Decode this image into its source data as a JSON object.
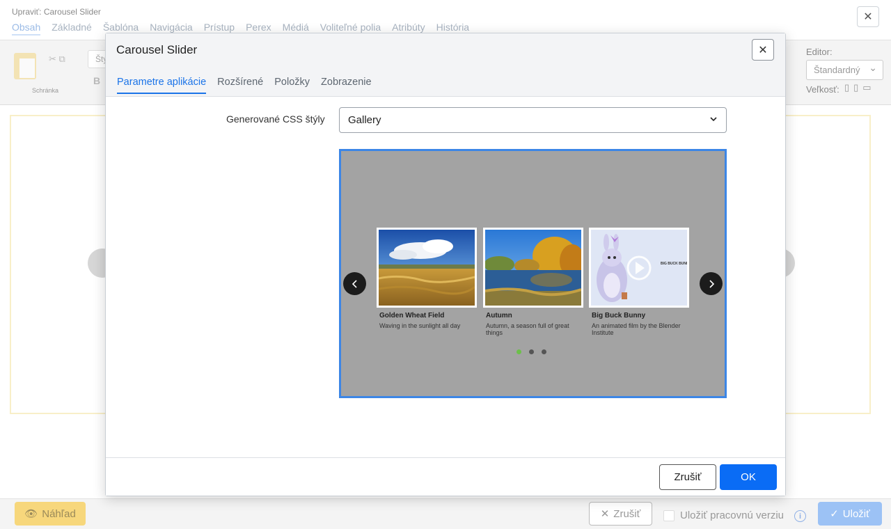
{
  "background": {
    "title": "Upraviť: Carousel Slider",
    "tabs": [
      "Obsah",
      "Základné",
      "Šablóna",
      "Navigácia",
      "Prístup",
      "Perex",
      "Médiá",
      "Voliteľné polia",
      "Atribúty",
      "História"
    ],
    "active_tab": "Obsah",
    "toolbar": {
      "clipboard_label": "Schránka",
      "style_placeholder": "Šty",
      "editor_label": "Editor:",
      "editor_value": "Štandardný",
      "size_label": "Veľkosť:"
    },
    "footer": {
      "preview_label": "Náhľad",
      "cancel_label": "Zrušiť",
      "draft_label": "Uložiť pracovnú verziu",
      "save_label": "Uložiť"
    }
  },
  "modal": {
    "title": "Carousel Slider",
    "tabs": [
      "Parametre aplikácie",
      "Rozšírené",
      "Položky",
      "Zobrazenie"
    ],
    "active_tab": "Parametre aplikácie",
    "field_label": "Generované CSS štýly",
    "field_value": "Gallery",
    "slides": [
      {
        "title": "Golden Wheat Field",
        "text": "Waving in the sunlight all day",
        "image": "wheat-field-image"
      },
      {
        "title": "Autumn",
        "text": "Autumn, a season full of great things",
        "image": "autumn-lake-image"
      },
      {
        "title": "Big Buck Bunny",
        "text": "An animated film by the Blender Institute",
        "image": "big-buck-bunny-video-thumbnail"
      }
    ],
    "pager_count": 3,
    "pager_active": 0,
    "cancel_label": "Zrušiť",
    "ok_label": "OK"
  },
  "colors": {
    "accent": "#1a73e8",
    "ok_button": "#0a6cf5",
    "preview_border": "#3c86e6",
    "pager_active": "#6cc04a"
  }
}
